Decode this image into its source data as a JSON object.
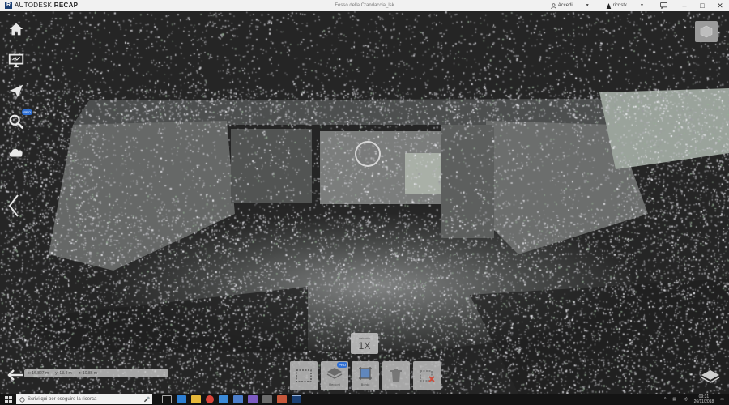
{
  "titlebar": {
    "brand_prefix": "AUTODESK",
    "brand_product": "RECAP",
    "document_title": "Fosso della Crandaccia_lsk",
    "account_label": "Accedi",
    "user_label": "ricristk",
    "window_controls": [
      "–",
      "□",
      "✕"
    ]
  },
  "left_toolbar": {
    "items": [
      {
        "name": "home",
        "icon": "home-icon"
      },
      {
        "name": "display",
        "icon": "monitor-icon"
      },
      {
        "name": "navigate",
        "icon": "paper-plane-icon"
      },
      {
        "name": "search",
        "icon": "magnifier-icon",
        "badge": "PRO"
      },
      {
        "name": "cloud",
        "icon": "cloud-icon"
      }
    ]
  },
  "speed_widget": {
    "label": "velocità",
    "value": "1X"
  },
  "bottom_tools": [
    {
      "name": "select-window",
      "label": "",
      "icon": "dashed-rect-icon"
    },
    {
      "name": "regions",
      "label": "Regioni",
      "icon": "layers-stack-icon",
      "badge": "PRO"
    },
    {
      "name": "bounds",
      "label": "Bordo",
      "icon": "crop-icon"
    },
    {
      "name": "delete",
      "label": "",
      "icon": "trash-icon"
    },
    {
      "name": "clip",
      "label": "",
      "icon": "clip-remove-icon"
    }
  ],
  "coordinates": {
    "x": "16.827 m",
    "y": "13.4 m",
    "z": "10.86 m"
  },
  "taskbar": {
    "search_placeholder": "Scrivi qui per eseguire la ricerca",
    "time": "09:31",
    "date": "26/11/2018"
  },
  "colors": {
    "accent_blue": "#2f6fd3",
    "brand_dark": "#1b3f73",
    "viewport_bg": "#232323"
  }
}
